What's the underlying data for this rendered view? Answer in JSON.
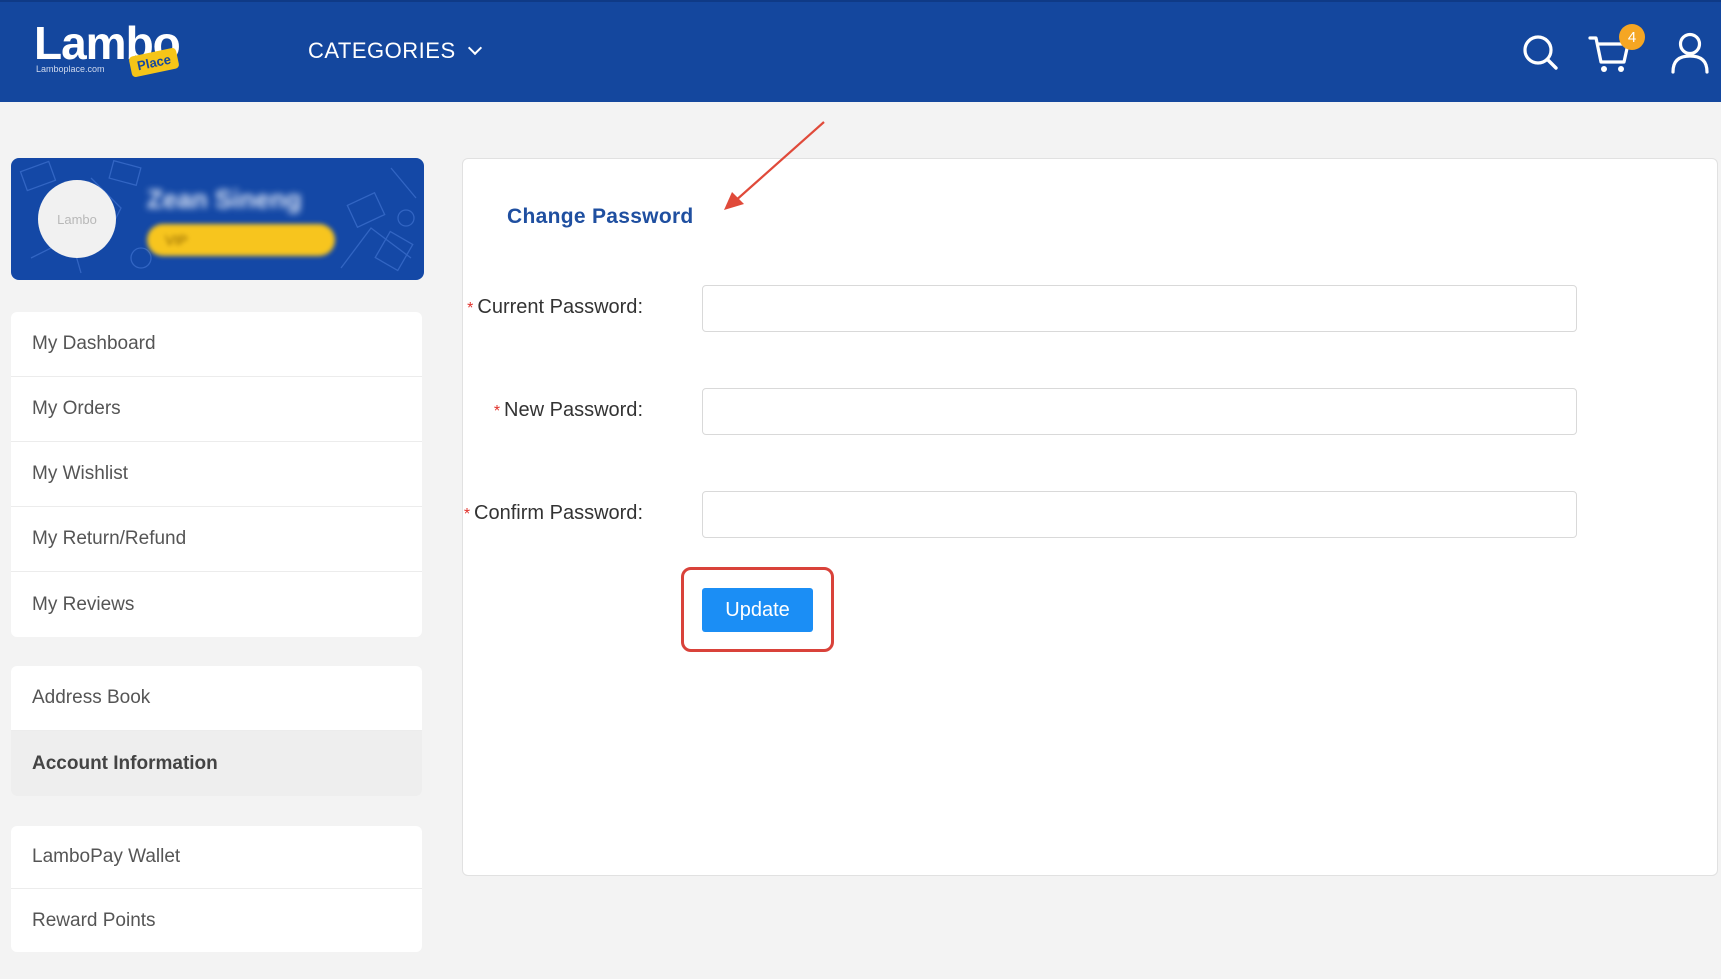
{
  "header": {
    "logo_text": "Lambo",
    "logo_tag": "Place",
    "logo_subtext": "Lamboplace.com",
    "categories_label": "CATEGORIES",
    "cart_count": "4",
    "icons": [
      "search-icon",
      "cart-icon",
      "user-icon"
    ],
    "background_color": "#14479e"
  },
  "profile": {
    "avatar_text": "Lambo",
    "name": "Zean Sineng",
    "badge": "VIP"
  },
  "sidebar": {
    "group1": [
      {
        "label": "My Dashboard"
      },
      {
        "label": "My Orders"
      },
      {
        "label": "My Wishlist"
      },
      {
        "label": "My Return/Refund"
      },
      {
        "label": "My Reviews"
      }
    ],
    "group2": [
      {
        "label": "Address Book"
      },
      {
        "label": "Account Information",
        "active": true
      }
    ],
    "group3": [
      {
        "label": "LamboPay Wallet"
      },
      {
        "label": "Reward Points"
      }
    ]
  },
  "form": {
    "title": "Change Password",
    "required_mark": "*",
    "fields": [
      {
        "label": "Current Password",
        "value": "",
        "placeholder": ""
      },
      {
        "label": "New Password",
        "value": "",
        "placeholder": ""
      },
      {
        "label": "Confirm Password",
        "value": "",
        "placeholder": ""
      }
    ],
    "colon": ":",
    "submit_label": "Update",
    "submit_color": "#1b8ef5",
    "annotation_color": "#d9423a"
  }
}
